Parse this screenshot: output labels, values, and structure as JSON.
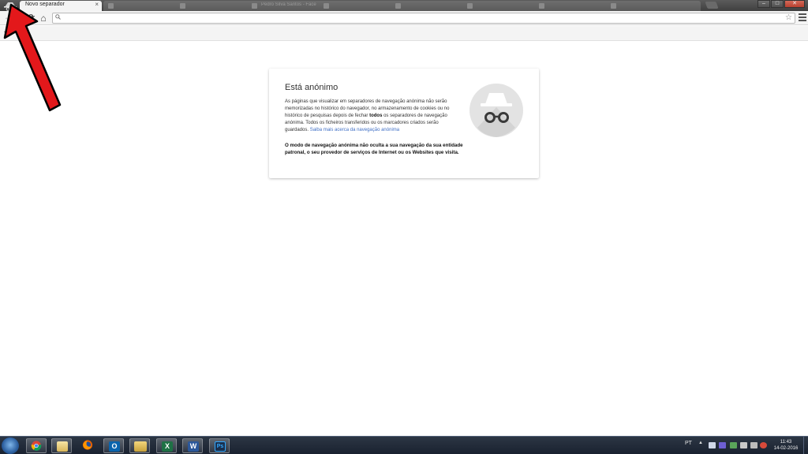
{
  "browser": {
    "active_tab": {
      "title": "Novo separador",
      "close": "×"
    },
    "background_tabs": [
      {
        "title": ""
      },
      {
        "title": ""
      },
      {
        "title": "Pedro Silva Santos - Facebook"
      },
      {
        "title": ""
      },
      {
        "title": ""
      },
      {
        "title": ""
      },
      {
        "title": ""
      },
      {
        "title": ""
      }
    ],
    "window_buttons": {
      "minimize": "–",
      "maximize": "□",
      "close": "✕"
    }
  },
  "toolbar": {
    "back": "←",
    "forward": "→",
    "reload": "⟳",
    "home": "⌂",
    "omnibox_value": "",
    "search_icon": "🔍",
    "star_icon": "☆"
  },
  "bookmarks": {
    "star": "★"
  },
  "incognito_card": {
    "title": "Está anónimo",
    "body_part1": "As páginas que visualizar em separadores de navegação anónima não serão memorizadas no histórico do navegador, no armazenamento de cookies ou no histórico de pesquisas depois de fechar ",
    "body_bold": "todos",
    "body_part2": " os separadores de navegação anónima. Todos os ficheiros transferidos ou os marcadores criados serão guardados. ",
    "learn_more": "Saiba mais acerca da navegação anónima",
    "warning": "O modo de navegação anónima não oculta a sua navegação da sua entidade patronal, o seu provedor de serviços de Internet ou os Websites que visita."
  },
  "taskbar": {
    "language": "PT",
    "tray_arrow": "▲",
    "time": "11:43",
    "date": "14-02-2016",
    "apps": [
      "chrome",
      "file-explorer",
      "firefox",
      "outlook",
      "folder",
      "excel",
      "word",
      "photoshop"
    ]
  },
  "colors": {
    "link": "#3f6fc5",
    "arrow": "#e3181b",
    "excel": "#1e7145",
    "word": "#2b579a",
    "outlook": "#0a64ad",
    "photoshop": "#1a2f4c"
  }
}
